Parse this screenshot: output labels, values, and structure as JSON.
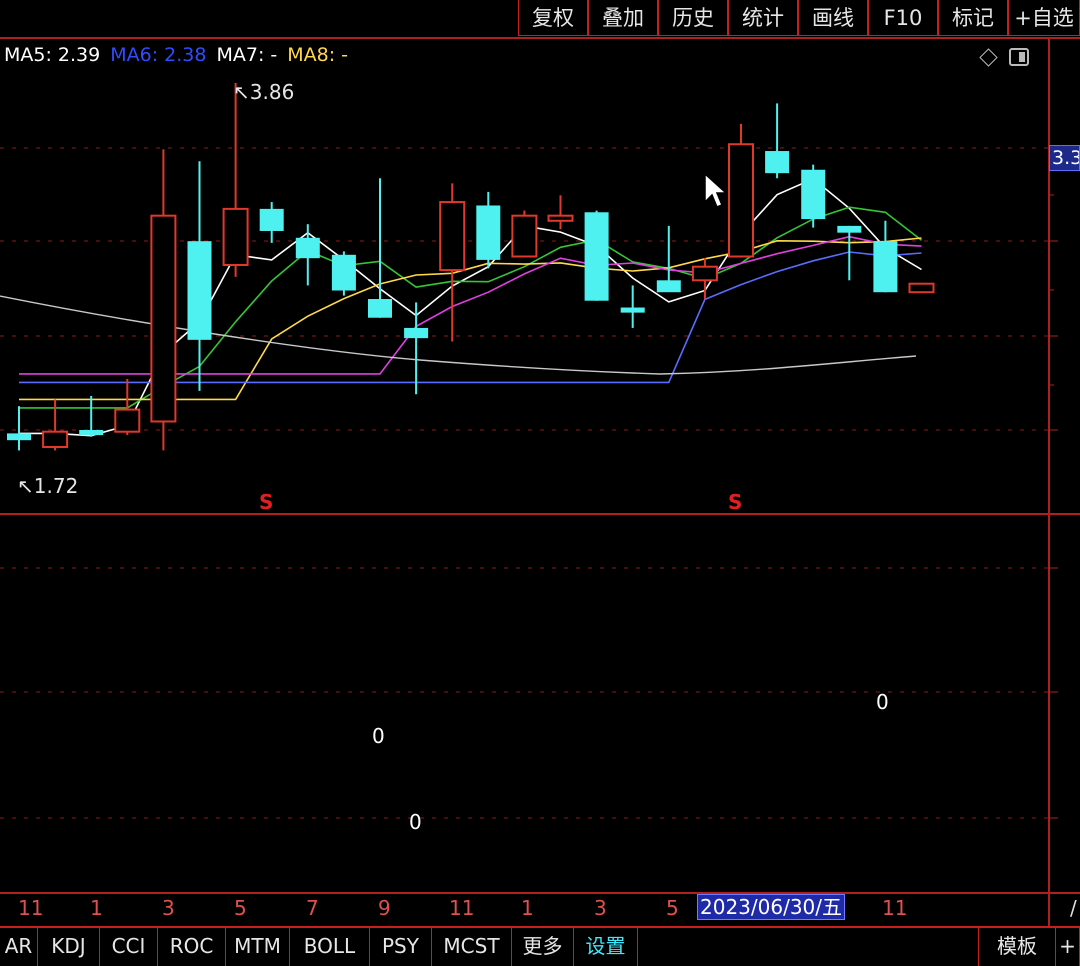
{
  "toolbar": {
    "buttons": [
      "复权",
      "叠加",
      "历史",
      "统计",
      "画线",
      "F10",
      "标记",
      "+自选"
    ]
  },
  "legend": {
    "ma5": "MA5: 2.39",
    "ma6": "MA6: 2.38",
    "ma7": "MA7: -",
    "ma8": "MA8: -"
  },
  "price_tag": "3.3",
  "high_label": "3.86",
  "low_label": "1.72",
  "signal_marks": [
    "S",
    "S"
  ],
  "indicator_zeros": [
    "0",
    "0",
    "0"
  ],
  "xaxis": {
    "labels": [
      "11",
      "1",
      "3",
      "5",
      "7",
      "9",
      "11",
      "1",
      "3",
      "5",
      "11"
    ],
    "crosshair_date": "2023/06/30/五",
    "end_label": "/"
  },
  "tabs": [
    "AR",
    "KDJ",
    "CCI",
    "ROC",
    "MTM",
    "BOLL",
    "PSY",
    "MCST",
    "更多",
    "设置",
    "模板",
    "+"
  ],
  "active_tab": "设置",
  "colors": {
    "rise": "#e0382b",
    "fall": "#4ff0f0",
    "grid": "#b02020",
    "ma5": "#ffffff",
    "ma6": "#2f4cff",
    "ma7": "#ffffff",
    "ma8": "#ffd94a",
    "green_line": "#35c435",
    "magenta_line": "#e040e0",
    "blue_line": "#5a6cff"
  },
  "chart_data": {
    "type": "candlestick",
    "candles": [
      {
        "o": 1.8,
        "h": 1.96,
        "l": 1.7,
        "c": 1.76,
        "dir": "down"
      },
      {
        "o": 1.72,
        "h": 2.0,
        "l": 1.7,
        "c": 1.81,
        "dir": "up"
      },
      {
        "o": 1.82,
        "h": 2.02,
        "l": 1.78,
        "c": 1.79,
        "dir": "down"
      },
      {
        "o": 1.81,
        "h": 2.12,
        "l": 1.79,
        "c": 1.94,
        "dir": "up"
      },
      {
        "o": 1.87,
        "h": 3.47,
        "l": 1.7,
        "c": 3.08,
        "dir": "up"
      },
      {
        "o": 2.93,
        "h": 3.4,
        "l": 2.05,
        "c": 2.35,
        "dir": "down"
      },
      {
        "o": 2.79,
        "h": 3.86,
        "l": 2.72,
        "c": 3.12,
        "dir": "up"
      },
      {
        "o": 3.12,
        "h": 3.16,
        "l": 2.92,
        "c": 2.99,
        "dir": "down"
      },
      {
        "o": 2.95,
        "h": 3.03,
        "l": 2.67,
        "c": 2.83,
        "dir": "down"
      },
      {
        "o": 2.85,
        "h": 2.87,
        "l": 2.61,
        "c": 2.64,
        "dir": "down"
      },
      {
        "o": 2.59,
        "h": 3.3,
        "l": 2.48,
        "c": 2.48,
        "dir": "down"
      },
      {
        "o": 2.42,
        "h": 2.57,
        "l": 2.03,
        "c": 2.36,
        "dir": "down"
      },
      {
        "o": 2.76,
        "h": 3.27,
        "l": 2.34,
        "c": 3.16,
        "dir": "up"
      },
      {
        "o": 3.14,
        "h": 3.22,
        "l": 2.77,
        "c": 2.82,
        "dir": "down"
      },
      {
        "o": 2.84,
        "h": 3.11,
        "l": 2.84,
        "c": 3.08,
        "dir": "up"
      },
      {
        "o": 3.08,
        "h": 3.2,
        "l": 3.0,
        "c": 3.05,
        "dir": "up"
      },
      {
        "o": 3.1,
        "h": 3.11,
        "l": 2.58,
        "c": 2.58,
        "dir": "down"
      },
      {
        "o": 2.54,
        "h": 2.67,
        "l": 2.42,
        "c": 2.51,
        "dir": "down"
      },
      {
        "o": 2.7,
        "h": 3.02,
        "l": 2.64,
        "c": 2.63,
        "dir": "down"
      },
      {
        "o": 2.7,
        "h": 2.83,
        "l": 2.59,
        "c": 2.78,
        "dir": "up"
      },
      {
        "o": 2.84,
        "h": 3.62,
        "l": 2.84,
        "c": 3.5,
        "dir": "up"
      },
      {
        "o": 3.46,
        "h": 3.74,
        "l": 3.3,
        "c": 3.33,
        "dir": "down"
      },
      {
        "o": 3.35,
        "h": 3.38,
        "l": 3.01,
        "c": 3.06,
        "dir": "down"
      },
      {
        "o": 3.02,
        "h": 3.02,
        "l": 2.7,
        "c": 2.98,
        "dir": "down"
      },
      {
        "o": 2.93,
        "h": 3.05,
        "l": 2.63,
        "c": 2.63,
        "dir": "down"
      },
      {
        "o": 2.63,
        "h": 2.68,
        "l": 2.63,
        "c": 2.68,
        "dir": "up"
      }
    ],
    "ylim": [
      1.5,
      4.0
    ]
  }
}
